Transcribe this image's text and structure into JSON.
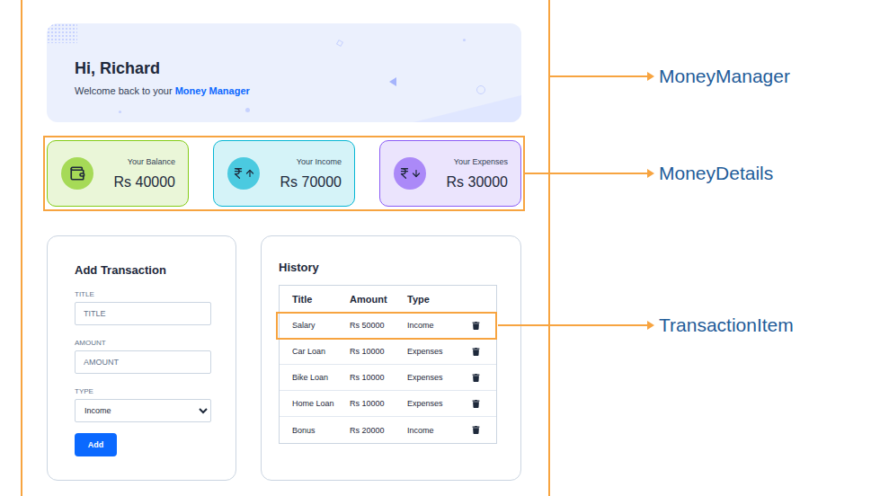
{
  "app": {
    "greeting": "Hi, Richard",
    "welcome": "Welcome back to your",
    "brand": "Money Manager"
  },
  "money_details": [
    {
      "kind": "balance",
      "label": "Your Balance",
      "amount": "Rs 40000",
      "color": "#84cc16"
    },
    {
      "kind": "income",
      "label": "Your Income",
      "amount": "Rs 70000",
      "color": "#06b6d4"
    },
    {
      "kind": "expenses",
      "label": "Your Expenses",
      "amount": "Rs 30000",
      "color": "#8b5cf6"
    }
  ],
  "form": {
    "title": "Add Transaction",
    "fields": [
      {
        "label": "TITLE",
        "placeholder": "TITLE"
      },
      {
        "label": "AMOUNT",
        "placeholder": "AMOUNT"
      }
    ],
    "type": {
      "label": "TYPE",
      "value": "Income"
    },
    "button": "Add"
  },
  "history": {
    "title": "History",
    "columns": [
      "Title",
      "Amount",
      "Type"
    ],
    "rows": [
      {
        "title": "Salary",
        "amount": "Rs 50000",
        "type": "Income",
        "annotated": true
      },
      {
        "title": "Car Loan",
        "amount": "Rs 10000",
        "type": "Expenses",
        "annotated": false
      },
      {
        "title": "Bike Loan",
        "amount": "Rs 10000",
        "type": "Expenses",
        "annotated": false
      },
      {
        "title": "Home Loan",
        "amount": "Rs 10000",
        "type": "Expenses",
        "annotated": false
      },
      {
        "title": "Bonus",
        "amount": "Rs 20000",
        "type": "Income",
        "annotated": false
      }
    ]
  },
  "annotations": [
    {
      "label": "MoneyManager"
    },
    {
      "label": "MoneyDetails"
    },
    {
      "label": "TransactionItem"
    }
  ]
}
